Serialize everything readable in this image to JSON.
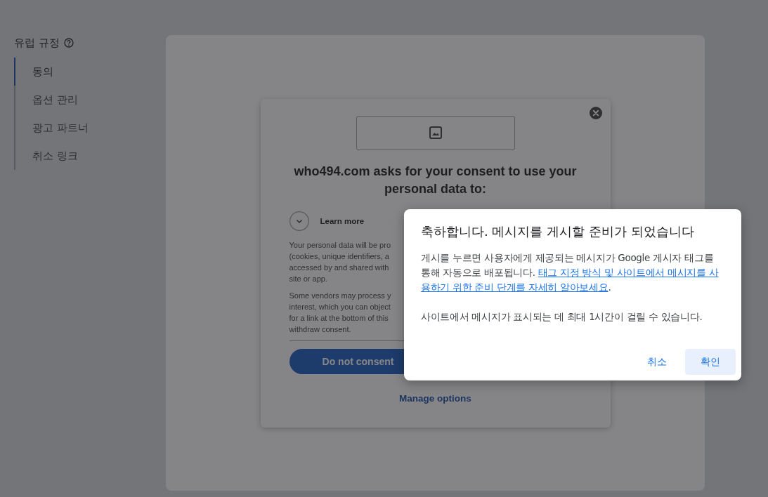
{
  "sidebar": {
    "title": "유럽 규정",
    "items": [
      {
        "label": "동의",
        "selected": true
      },
      {
        "label": "옵션 관리",
        "selected": false
      },
      {
        "label": "광고 파트너",
        "selected": false
      },
      {
        "label": "취소 링크",
        "selected": false
      }
    ]
  },
  "consent_card": {
    "heading": "who494.com asks for your consent to use your personal data to:",
    "learn_more": "Learn more",
    "paragraphs": [
      [
        "Your personal data will be pro",
        "(cookies, unique identifiers, a",
        "accessed by and shared with",
        "site or app."
      ],
      [
        "Some vendors may process y",
        "interest, which you can object",
        "for a link at the bottom of this",
        "withdraw consent."
      ]
    ],
    "primary_button": "Do not consent",
    "manage_link": "Manage options"
  },
  "dialog": {
    "title": "축하합니다. 메시지를 게시할 준비가 되었습니다",
    "body": {
      "text": "게시를 누르면 사용자에게 제공되는 메시지가 Google 게시자 태그를 통해 자동으로 배포됩니다. ",
      "link_lines": [
        "태그 지정 방식 및 사이트에서 메시지를 사",
        "용하기 위한 준비 단계를 자세히 알아보세요"
      ],
      "after": "."
    },
    "note": "사이트에서 메시지가 표시되는 데 최대 1시간이 걸릴 수 있습니다.",
    "buttons": [
      {
        "label": "취소",
        "kind": "text"
      },
      {
        "label": "확인",
        "kind": "tonal"
      }
    ]
  }
}
